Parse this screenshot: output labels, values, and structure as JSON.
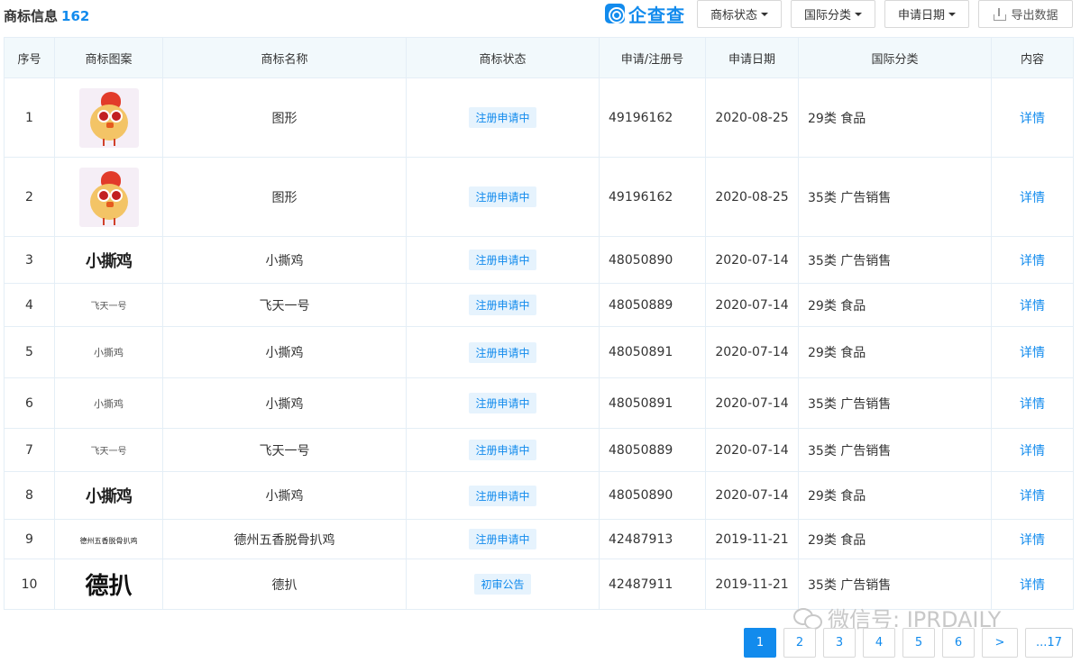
{
  "header": {
    "title": "商标信息",
    "count": "162",
    "brand": "企查查",
    "filters": [
      {
        "label": "商标状态"
      },
      {
        "label": "国际分类"
      },
      {
        "label": "申请日期"
      }
    ],
    "export_label": "导出数据"
  },
  "table": {
    "columns": [
      "序号",
      "商标图案",
      "商标名称",
      "商标状态",
      "申请/注册号",
      "申请日期",
      "国际分类",
      "内容"
    ],
    "rows": [
      {
        "no": "1",
        "logo": "chick",
        "name": "图形",
        "status": "注册申请中",
        "reg": "49196162",
        "date": "2020-08-25",
        "cls": "29类 食品",
        "detail": "详情"
      },
      {
        "no": "2",
        "logo": "chick",
        "name": "图形",
        "status": "注册申请中",
        "reg": "49196162",
        "date": "2020-08-25",
        "cls": "35类 广告销售",
        "detail": "详情"
      },
      {
        "no": "3",
        "logo": "小撕鸡",
        "name": "小撕鸡",
        "status": "注册申请中",
        "reg": "48050890",
        "date": "2020-07-14",
        "cls": "35类 广告销售",
        "detail": "详情"
      },
      {
        "no": "4",
        "logo": "飞天一号",
        "name": "飞天一号",
        "status": "注册申请中",
        "reg": "48050889",
        "date": "2020-07-14",
        "cls": "29类 食品",
        "detail": "详情"
      },
      {
        "no": "5",
        "logo": "小撕鸡",
        "name": "小撕鸡",
        "status": "注册申请中",
        "reg": "48050891",
        "date": "2020-07-14",
        "cls": "29类 食品",
        "detail": "详情"
      },
      {
        "no": "6",
        "logo": "小撕鸡",
        "name": "小撕鸡",
        "status": "注册申请中",
        "reg": "48050891",
        "date": "2020-07-14",
        "cls": "35类 广告销售",
        "detail": "详情"
      },
      {
        "no": "7",
        "logo": "飞天一号",
        "name": "飞天一号",
        "status": "注册申请中",
        "reg": "48050889",
        "date": "2020-07-14",
        "cls": "35类 广告销售",
        "detail": "详情"
      },
      {
        "no": "8",
        "logo": "小撕鸡",
        "name": "小撕鸡",
        "status": "注册申请中",
        "reg": "48050890",
        "date": "2020-07-14",
        "cls": "29类 食品",
        "detail": "详情"
      },
      {
        "no": "9",
        "logo": "德州五香脱骨扒鸡",
        "name": "德州五香脱骨扒鸡",
        "status": "注册申请中",
        "reg": "42487913",
        "date": "2019-11-21",
        "cls": "29类 食品",
        "detail": "详情"
      },
      {
        "no": "10",
        "logo": "德扒",
        "name": "德扒",
        "status": "初审公告",
        "reg": "42487911",
        "date": "2019-11-21",
        "cls": "35类 广告销售",
        "detail": "详情"
      }
    ]
  },
  "watermark": {
    "text": "微信号: IPRDAILY"
  },
  "pagination": {
    "pages": [
      "1",
      "2",
      "3",
      "4",
      "5",
      "6"
    ],
    "next": ">",
    "last": "...17",
    "current": "1"
  },
  "colors": {
    "accent": "#128bed",
    "header_bg": "#f2f9fc",
    "badge_bg": "#e6f3fd"
  }
}
